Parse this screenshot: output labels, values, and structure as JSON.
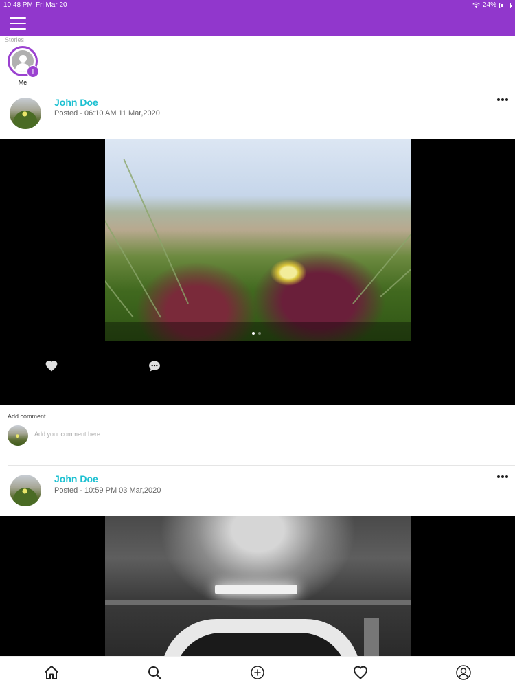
{
  "status_bar": {
    "time": "10:48 PM",
    "date": "Fri Mar 20",
    "battery": "24%",
    "battery_level": 0.24
  },
  "stories": {
    "label": "Stories",
    "items": [
      {
        "name": "Me"
      }
    ]
  },
  "posts": [
    {
      "author": "John Doe",
      "posted": "Posted - 06:10 AM 11 Mar,2020",
      "add_comment_label": "Add comment",
      "comment_placeholder": "Add your comment here..."
    },
    {
      "author": "John Doe",
      "posted": "Posted - 10:59 PM 03 Mar,2020"
    }
  ],
  "icons": {
    "menu": "hamburger-menu-icon",
    "more": "more-options-icon",
    "like": "heart-icon",
    "comment": "comment-bubble-icon",
    "tabs": [
      "home-icon",
      "search-icon",
      "add-circle-icon",
      "heart-icon",
      "profile-icon"
    ]
  },
  "colors": {
    "brand": "#9137cc",
    "author": "#1cc0d1",
    "media_background": "#000000"
  }
}
